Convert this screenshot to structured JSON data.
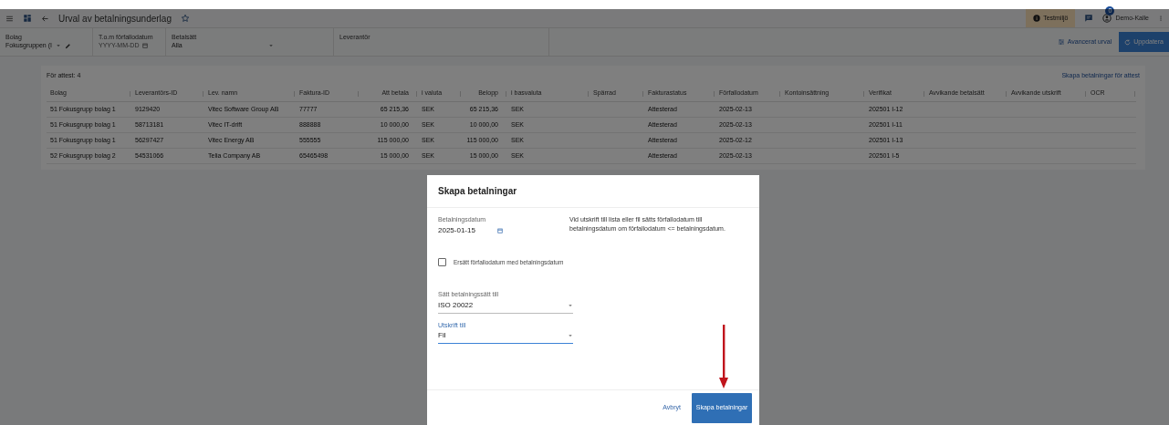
{
  "top_bar": {
    "title": "Urval av betalningsunderlag",
    "favorite": false,
    "environment_badge": "Testmiljö",
    "notification_count": "0",
    "user": "Demo-Kalle"
  },
  "filters": [
    {
      "kind": "select",
      "label": "Bolag",
      "value": "Fokusgruppen (I"
    },
    {
      "kind": "date",
      "label": "T.o.m förfallodatum",
      "placeholder": "YYYY-MM-DD"
    },
    {
      "kind": "select",
      "label": "Betalsätt",
      "value": "Alla"
    },
    {
      "kind": "text",
      "label": "Leverantör"
    }
  ],
  "toolbar_buttons": [
    {
      "kind": "text",
      "label": "Avancerat urval"
    },
    {
      "kind": "primary",
      "label": "Uppdatera"
    }
  ],
  "summary": "För attest: 4",
  "action_link": "Skapa betalningar för attest",
  "table": {
    "columns": [
      "Bolag",
      "Leverantörs-ID",
      "Lev. namn",
      "Faktura-ID",
      "Att betala",
      "i valuta",
      "Belopp",
      "i basvaluta",
      "Spärrad",
      "Fakturastatus",
      "Förfallodatum",
      "Kontoinsättning",
      "Verifikat",
      "Avvikande betalsätt",
      "Avvikande utskrift",
      "OCR"
    ],
    "rows": [
      [
        "51 Fokusgrupp bolag 1",
        "9129420",
        "Vitec Software Group AB",
        "77777",
        "65 215,36",
        "SEK",
        "65 215,36",
        "SEK",
        "",
        "Attesterad",
        "2025-02-13",
        "",
        "202501 I-12",
        "",
        "",
        ""
      ],
      [
        "51 Fokusgrupp bolag 1",
        "58713181",
        "Vitec IT-drift",
        "888888",
        "10 000,00",
        "SEK",
        "10 000,00",
        "SEK",
        "",
        "Attesterad",
        "2025-02-13",
        "",
        "202501 I-11",
        "",
        "",
        ""
      ],
      [
        "51 Fokusgrupp bolag 1",
        "56297427",
        "Vitec Energy AB",
        "555555",
        "115 000,00",
        "SEK",
        "115 000,00",
        "SEK",
        "",
        "Attesterad",
        "2025-02-12",
        "",
        "202501 I-13",
        "",
        "",
        ""
      ],
      [
        "52 Fokusgrupp bolag 2",
        "54531066",
        "Telia Company AB",
        "65465498",
        "15 000,00",
        "SEK",
        "15 000,00",
        "SEK",
        "",
        "Attesterad",
        "2025-02-13",
        "",
        "202501 I-5",
        "",
        "",
        ""
      ]
    ]
  },
  "dialog": {
    "title": "Skapa betalningar",
    "date_field": {
      "label": "Betalningsdatum",
      "value": "2025-01-15"
    },
    "info_text": "Vid utskrift till lista eller fil sätts förfallodatum till betalningsdatum om förfallodatum <= betalningsdatum.",
    "checkbox": {
      "label": "Ersätt förfallodatum med betalningsdatum",
      "checked": false
    },
    "selects": [
      {
        "label": "Sätt betalningssätt till",
        "value": "ISO 20022",
        "focused": false
      },
      {
        "label": "Utskrift till",
        "value": "Fil",
        "focused": true
      }
    ],
    "buttons": [
      {
        "kind": "text",
        "label": "Avbryt"
      },
      {
        "kind": "primary",
        "label": "Skapa betalningar"
      }
    ]
  }
}
